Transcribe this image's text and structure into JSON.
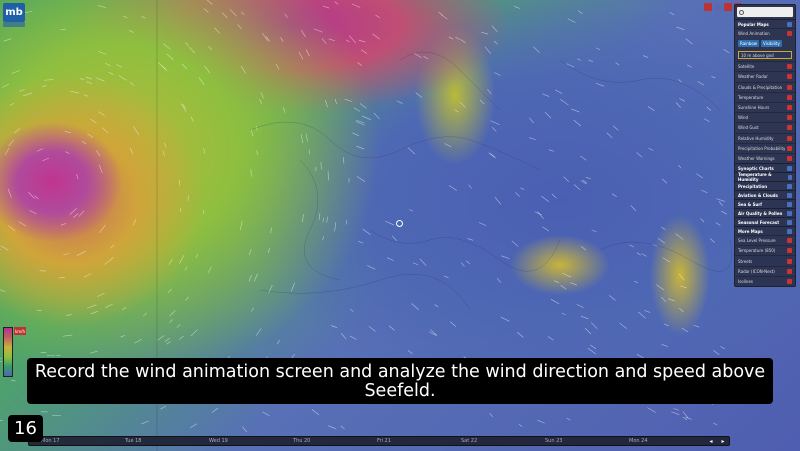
{
  "app": {
    "logo_text": "mb"
  },
  "panel": {
    "search_placeholder": "",
    "sections": [
      {
        "title": "Popular Maps",
        "items": [
          "Wind Animation",
          "Satellite",
          "Weather Radar",
          "Clouds & Precipitation",
          "Temperature",
          "Sunshine Hours",
          "Wind",
          "Wind Gust",
          "Relative Humidity",
          "Precipitation Probability",
          "Weather Warnings"
        ],
        "wind_options": {
          "style": "Rainbow",
          "visibility": "Visibility",
          "level": "10 m above gnd"
        }
      },
      {
        "title": "Synoptic Charts"
      },
      {
        "title": "Temperature & Humidity"
      },
      {
        "title": "Precipitation"
      },
      {
        "title": "Aviation & Clouds"
      },
      {
        "title": "Sea & Surf"
      },
      {
        "title": "Air Quality & Pollen"
      },
      {
        "title": "Seasonal Forecast"
      },
      {
        "title": "More Maps",
        "items": [
          "Sea Level Pressure",
          "Temperature (850)",
          "Streets",
          "Radar (ICON-Nest)",
          "Isolines"
        ]
      }
    ]
  },
  "caption": "Record the wind animation screen and analyze the wind direction and speed above Seefeld.",
  "step_number": "16",
  "timeline": {
    "days": [
      "Mon 17",
      "Tue 18",
      "Wed 19",
      "Thu 20",
      "Fri 21",
      "Sat 22",
      "Sun 23",
      "Mon 24"
    ],
    "prev": "◂",
    "next": "▸"
  },
  "legend": {
    "unit": "km/h"
  },
  "colors": {
    "caption_bg": "#000000",
    "panel_bg": "#282e46",
    "accent": "#c33333"
  }
}
